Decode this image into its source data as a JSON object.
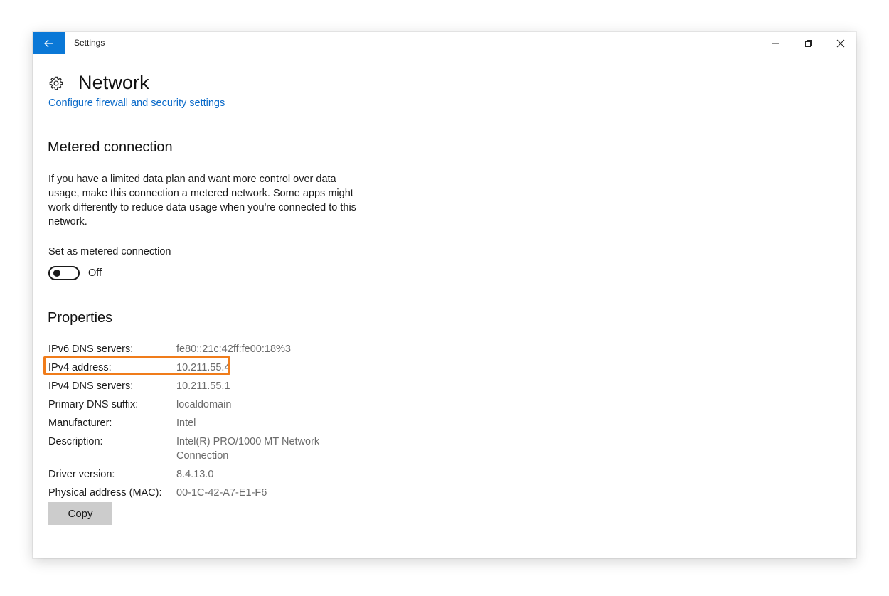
{
  "titlebar": {
    "app_title": "Settings",
    "back_icon": "arrow-left-icon",
    "minimize_icon": "minimize-icon",
    "restore_icon": "restore-icon",
    "close_icon": "close-icon"
  },
  "header": {
    "icon": "gear-icon",
    "title": "Network",
    "firewall_link": "Configure firewall and security settings"
  },
  "metered": {
    "section_title": "Metered connection",
    "description": "If you have a limited data plan and want more control over data usage, make this connection a metered network. Some apps might work differently to reduce data usage when you're connected to this network.",
    "toggle_label": "Set as metered connection",
    "toggle_state": "Off"
  },
  "properties": {
    "section_title": "Properties",
    "rows": [
      {
        "key": "IPv6 DNS servers:",
        "value": "fe80::21c:42ff:fe00:18%3"
      },
      {
        "key": "IPv4 address:",
        "value": "10.211.55.4"
      },
      {
        "key": "IPv4 DNS servers:",
        "value": "10.211.55.1"
      },
      {
        "key": "Primary DNS suffix:",
        "value": "localdomain"
      },
      {
        "key": "Manufacturer:",
        "value": "Intel"
      },
      {
        "key": "Description:",
        "value": "Intel(R) PRO/1000 MT Network Connection"
      },
      {
        "key": "Driver version:",
        "value": "8.4.13.0"
      },
      {
        "key": "Physical address (MAC):",
        "value": "00-1C-42-A7-E1-F6"
      }
    ],
    "copy_label": "Copy"
  },
  "colors": {
    "accent": "#0a78d7",
    "link": "#0a6ac9",
    "highlight": "#f07c1a",
    "button_bg": "#cccccc"
  }
}
